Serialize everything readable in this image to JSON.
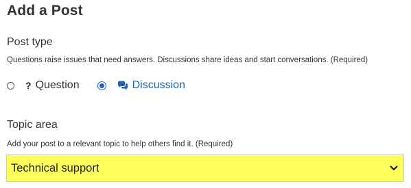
{
  "page": {
    "title": "Add a Post"
  },
  "post_type": {
    "label": "Post type",
    "help": "Questions raise issues that need answers. Discussions share ideas and start conversations. (Required)",
    "options": [
      {
        "icon": "question-mark-icon",
        "icon_glyph": "?",
        "label": "Question",
        "selected": false
      },
      {
        "icon": "chat-bubbles-icon",
        "label": "Discussion",
        "selected": true
      }
    ]
  },
  "topic_area": {
    "label": "Topic area",
    "help": "Add your post to a relevant topic to help others find it. (Required)",
    "selected_value": "Technical support",
    "highlight_color": "#ffff5a"
  },
  "colors": {
    "link_blue": "#1b65b3",
    "radio_blue": "#1a63c9"
  }
}
